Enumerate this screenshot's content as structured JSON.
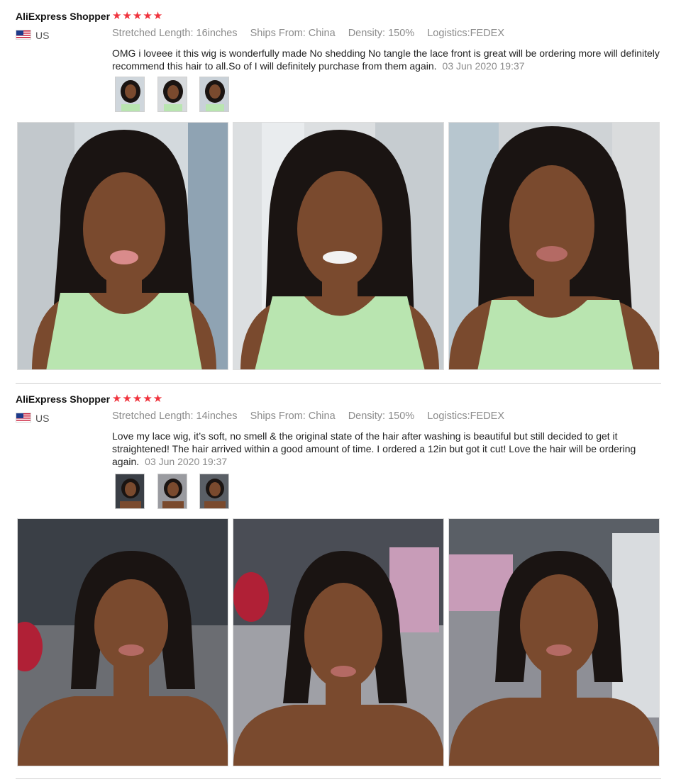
{
  "reviews": [
    {
      "author": "AliExpress Shopper",
      "rating": 5,
      "stars": "★★★★★",
      "country": "US",
      "attributes": {
        "length": "Stretched Length: 16inches",
        "ships_from": "Ships From: China",
        "density": "Density: 150%",
        "logistics": "Logistics:FEDEX"
      },
      "text": "OMG i loveee it this wig is wonderfully made No shedding No tangle the lace front is great will be ordering more will definitely recommend this hair to all.So of I will definitely purchase from them again.",
      "date": "03 Jun 2020 19:37"
    },
    {
      "author": "AliExpress Shopper",
      "rating": 5,
      "stars": "★★★★★",
      "country": "US",
      "attributes": {
        "length": "Stretched Length: 14inches",
        "ships_from": "Ships From: China",
        "density": "Density: 150%",
        "logistics": "Logistics:FEDEX"
      },
      "text": "Love my lace wig, it’s soft, no smell & the original state of the hair after washing is beautiful but still decided to get it straightened! The hair arrived within a good amount of time. I ordered a 12in but got it cut! Love the hair will be ordering again.",
      "date": "03 Jun 2020 19:37"
    }
  ],
  "colors": {
    "star": "#f0333d",
    "muted_text": "#8b8b8b",
    "divider": "#cfcfcf",
    "photo_bg_1": "#cfd6dc",
    "photo_bg_2": "#3a3f46",
    "tank_top": "#b9e5b0",
    "skin": "#7a4a2e",
    "hair": "#1a1412"
  },
  "icons": [
    "us-flag-icon",
    "star-icon"
  ]
}
